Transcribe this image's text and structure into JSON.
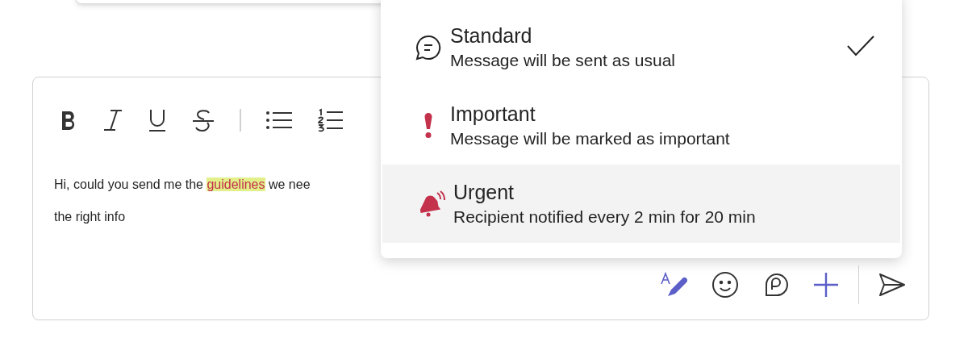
{
  "toolbar": [
    {
      "kind": "bold"
    },
    {
      "kind": "italic"
    },
    {
      "kind": "underline"
    },
    {
      "kind": "strike"
    },
    {
      "kind": "divider"
    },
    {
      "kind": "bullets"
    },
    {
      "kind": "numbered"
    }
  ],
  "message": {
    "lines": [
      [
        {
          "text": "Hi, could you send me the ",
          "highlighted": false
        },
        {
          "text": "guidelines",
          "highlighted": true
        },
        {
          "text": " we nee",
          "highlighted": false
        }
      ],
      [
        {
          "text": "the right info",
          "highlighted": false
        }
      ]
    ]
  },
  "actions": [
    {
      "kind": "format"
    },
    {
      "kind": "emoji"
    },
    {
      "kind": "loop"
    },
    {
      "kind": "plus"
    },
    {
      "kind": "send"
    }
  ],
  "priority_menu": {
    "items": [
      {
        "kind": "standard",
        "title": "Standard",
        "description": "Message will be sent as usual",
        "checked": true,
        "selected": false
      },
      {
        "kind": "important",
        "title": "Important",
        "description": "Message will be marked as important",
        "checked": false,
        "selected": false
      },
      {
        "kind": "urgent",
        "title": "Urgent",
        "description": "Recipient notified every 2 min for 20 min",
        "checked": false,
        "selected": true
      }
    ]
  }
}
